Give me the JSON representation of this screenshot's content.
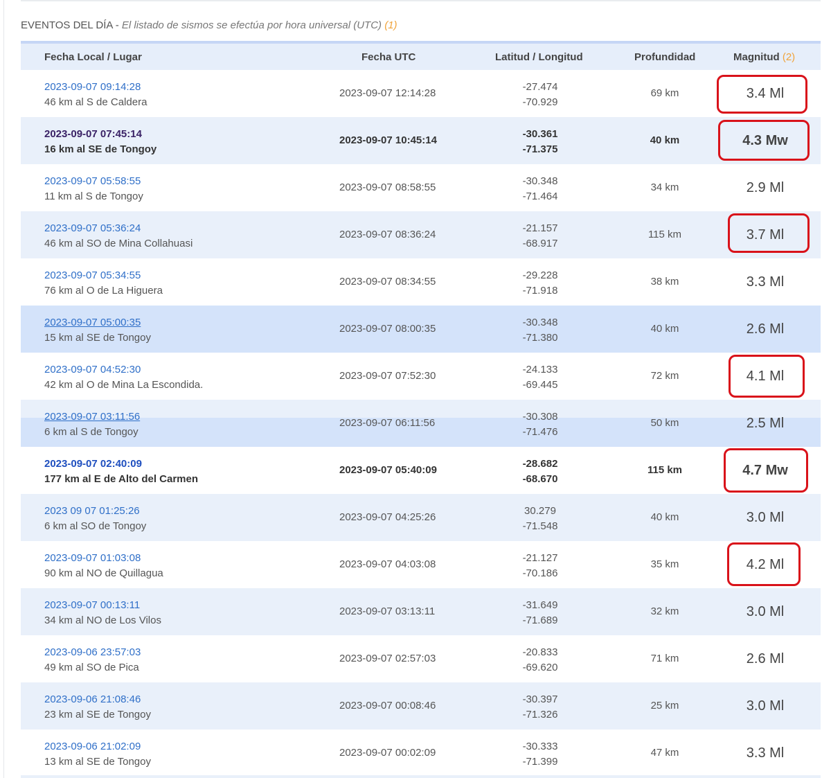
{
  "section": {
    "title": "EVENTOS DEL DÍA",
    "separator": " - ",
    "description": "El listado de sismos se efectúa por hora universal (UTC)",
    "note": " (1)"
  },
  "headers": {
    "local": "Fecha Local / Lugar",
    "utc": "Fecha UTC",
    "latlon": "Latitud / Longitud",
    "depth": "Profundidad",
    "magnitude": "Magnitud",
    "magnitude_note": " (2)"
  },
  "rows": [
    {
      "local_date": "2023-09-07 09:14:28",
      "place": "46 km al S de Caldera",
      "utc": "2023-09-07 12:14:28",
      "lat": "-27.474",
      "lon": "-70.929",
      "depth": "69 km",
      "magnitude": "3.4 Ml",
      "circled": true
    },
    {
      "local_date": "2023-09-07 07:45:14",
      "place": "16 km al SE de Tongoy",
      "utc": "2023-09-07 10:45:14",
      "lat": "-30.361",
      "lon": "-71.375",
      "depth": "40 km",
      "magnitude": "4.3 Mw",
      "circled": true
    },
    {
      "local_date": "2023-09-07 05:58:55",
      "place": "11 km al S de Tongoy",
      "utc": "2023-09-07 08:58:55",
      "lat": "-30.348",
      "lon": "-71.464",
      "depth": "34 km",
      "magnitude": "2.9 Ml",
      "circled": false
    },
    {
      "local_date": "2023-09-07 05:36:24",
      "place": "46 km al SO de Mina Collahuasi",
      "utc": "2023-09-07 08:36:24",
      "lat": "-21.157",
      "lon": "-68.917",
      "depth": "115 km",
      "magnitude": "3.7 Ml",
      "circled": true
    },
    {
      "local_date": "2023-09-07 05:34:55",
      "place": "76 km al O de La Higuera",
      "utc": "2023-09-07 08:34:55",
      "lat": "-29.228",
      "lon": "-71.918",
      "depth": "38 km",
      "magnitude": "3.3 Ml",
      "circled": false
    },
    {
      "local_date": "2023-09-07 05:00:35",
      "place": "15 km al SE de Tongoy",
      "utc": "2023-09-07 08:00:35",
      "lat": "-30.348",
      "lon": "-71.380",
      "depth": "40 km",
      "magnitude": "2.6 Ml",
      "circled": false
    },
    {
      "local_date": "2023-09-07 04:52:30",
      "place": "42 km al O de Mina La Escondida.",
      "utc": "2023-09-07 07:52:30",
      "lat": "-24.133",
      "lon": "-69.445",
      "depth": "72 km",
      "magnitude": "4.1 Ml",
      "circled": true
    },
    {
      "local_date": "2023-09-07 03:11:56",
      "place": "6 km al S de Tongoy",
      "utc": "2023-09-07 06:11:56",
      "lat": "-30.308",
      "lon": "-71.476",
      "depth": "50 km",
      "magnitude": "2.5 Ml",
      "circled": false
    },
    {
      "local_date": "2023-09-07 02:40:09",
      "place": "177 km al E de Alto del Carmen",
      "utc": "2023-09-07 05:40:09",
      "lat": "-28.682",
      "lon": "-68.670",
      "depth": "115 km",
      "magnitude": "4.7 Mw",
      "circled": true
    },
    {
      "local_date": "2023 09 07 01:25:26",
      "place": "6 km al SO de Tongoy",
      "utc": "2023-09-07 04:25:26",
      "lat": "30.279",
      "lon": "-71.548",
      "depth": "40 km",
      "magnitude": "3.0 Ml",
      "circled": false
    },
    {
      "local_date": "2023-09-07 01:03:08",
      "place": "90 km al NO de Quillagua",
      "utc": "2023-09-07 04:03:08",
      "lat": "-21.127",
      "lon": "-70.186",
      "depth": "35 km",
      "magnitude": "4.2 Ml",
      "circled": true
    },
    {
      "local_date": "2023-09-07 00:13:11",
      "place": "34 km al NO de Los Vilos",
      "utc": "2023-09-07 03:13:11",
      "lat": "-31.649",
      "lon": "-71.689",
      "depth": "32 km",
      "magnitude": "3.0 Ml",
      "circled": false
    },
    {
      "local_date": "2023-09-06 23:57:03",
      "place": "49 km al SO de Pica",
      "utc": "2023-09-07 02:57:03",
      "lat": "-20.833",
      "lon": "-69.620",
      "depth": "71 km",
      "magnitude": "2.6 Ml",
      "circled": false
    },
    {
      "local_date": "2023-09-06 21:08:46",
      "place": "23 km al SE de Tongoy",
      "utc": "2023-09-07 00:08:46",
      "lat": "-30.397",
      "lon": "-71.326",
      "depth": "25 km",
      "magnitude": "3.0 Ml",
      "circled": false
    },
    {
      "local_date": "2023-09-06 21:02:09",
      "place": "13 km al SE de Tongoy",
      "utc": "2023-09-07 00:02:09",
      "lat": "-30.333",
      "lon": "-71.399",
      "depth": "47 km",
      "magnitude": "3.3 Ml",
      "circled": false
    }
  ],
  "colors": {
    "link": "#2f6fc8",
    "header_bg": "#e6eefa",
    "row_alt_bg": "#e9f0fa",
    "row_highlight_bg": "#d4e3fa",
    "note": "#f0a33a",
    "circle": "#d9121a"
  }
}
